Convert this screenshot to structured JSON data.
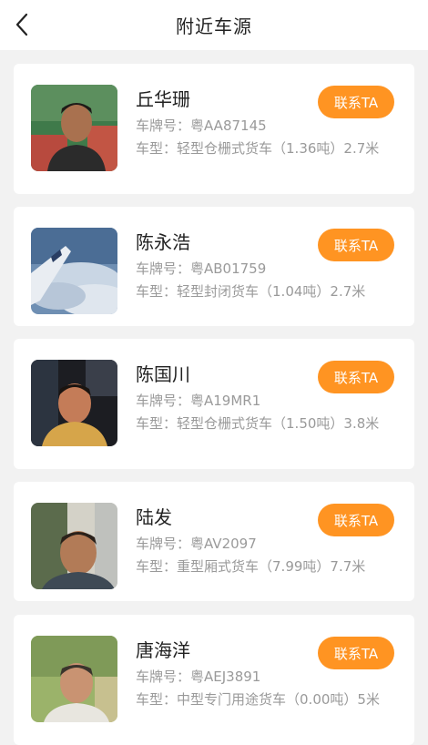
{
  "header": {
    "title": "附近车源",
    "back_icon": "chevron-left-icon"
  },
  "colors": {
    "accent": "#ff9422",
    "background": "#f2f2f2",
    "card": "#ffffff",
    "secondary_text": "#9a9a9a"
  },
  "vehicles": [
    {
      "name": "丘华珊",
      "plate": "车牌号：粤AA87145",
      "model": "车型：轻型仓栅式货车（1.36吨）2.7米",
      "contact_label": "联系TA"
    },
    {
      "name": "陈永浩",
      "plate": "车牌号：粤AB01759",
      "model": "车型：轻型封闭货车（1.04吨）2.7米",
      "contact_label": "联系TA"
    },
    {
      "name": "陈国川",
      "plate": "车牌号：粤A19MR1",
      "model": "车型：轻型仓栅式货车（1.50吨）3.8米",
      "contact_label": "联系TA"
    },
    {
      "name": "陆发",
      "plate": "车牌号：粤AV2097",
      "model": "车型：重型厢式货车（7.99吨）7.7米",
      "contact_label": "联系TA"
    },
    {
      "name": "唐海洋",
      "plate": "车牌号：粤AEJ3891",
      "model": "车型：中型专门用途货车（0.00吨）5米",
      "contact_label": "联系TA"
    }
  ]
}
